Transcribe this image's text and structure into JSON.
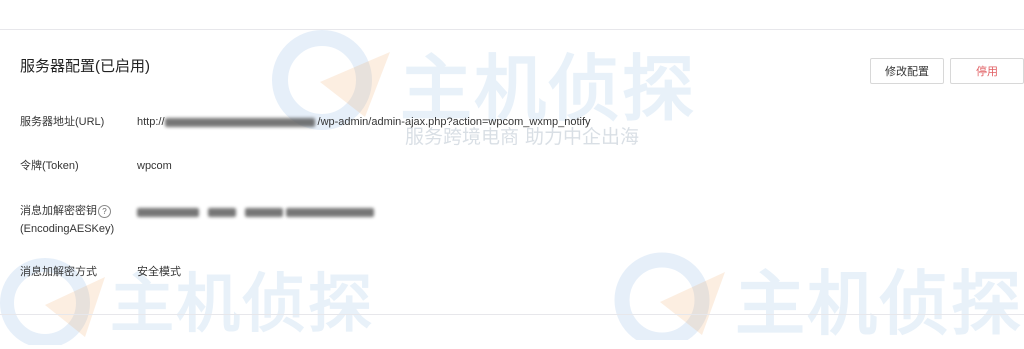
{
  "section": {
    "title": "服务器配置(已启用)",
    "edit_label": "修改配置",
    "stop_label": "停用"
  },
  "fields": {
    "url": {
      "label": "服务器地址(URL)",
      "prefix": "http://",
      "suffix": "/wp-admin/admin-ajax.php?action=wpcom_wxmp_notify"
    },
    "token": {
      "label": "令牌(Token)",
      "value": "wpcom"
    },
    "aeskey": {
      "label_line1": "消息加解密密钥",
      "label_line2": "(EncodingAESKey)",
      "help_glyph": "?"
    },
    "mode": {
      "label": "消息加解密方式",
      "value": "安全模式"
    }
  },
  "watermark": {
    "text": "主机侦探",
    "subtitle": "服务跨境电商  助力中企出海"
  },
  "colors": {
    "danger": "#e15f63",
    "border": "#d8d8d8",
    "watermark": "#4c90d1"
  }
}
